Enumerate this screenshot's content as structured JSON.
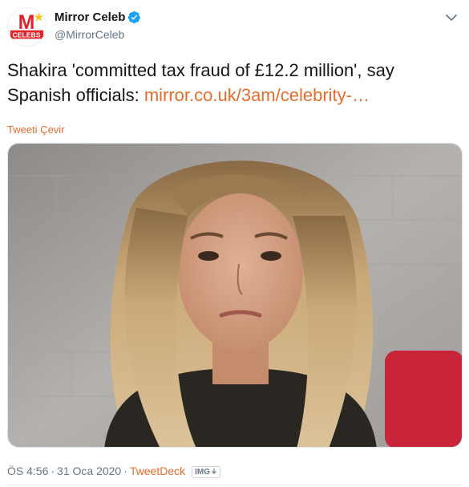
{
  "author": {
    "name": "Mirror Celeb",
    "handle": "@MirrorCeleb",
    "avatar_letter": "M",
    "avatar_text": "CELEBS",
    "brand_color": "#e0242c"
  },
  "tweet": {
    "text_line1": "Shakira 'committed tax fraud of £12.2 million', say",
    "text_line2_prefix": "Spanish officials: ",
    "link_text": "mirror.co.uk/3am/celebrity-…",
    "translate_label": "Tweeti Çevir"
  },
  "meta": {
    "time": "ÖS 4:56",
    "date": "31 Oca 2020",
    "separator": "·",
    "source": "TweetDeck",
    "badge": "IMG"
  },
  "colors": {
    "accent": "#e56c2b",
    "verified": "#1da1f2",
    "muted": "#657786"
  },
  "icons": {
    "verified": "verified-badge-icon",
    "more": "chevron-down-icon",
    "badge_arrow": "arrow-down-icon"
  }
}
